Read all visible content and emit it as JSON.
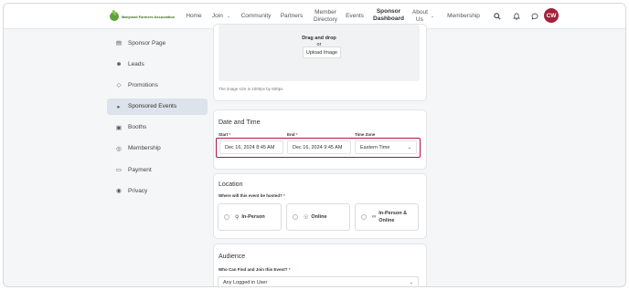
{
  "header": {
    "logo_text": "Maryland Farmers Association",
    "nav": [
      {
        "label": "Home"
      },
      {
        "label": "Join"
      },
      {
        "label": "Community"
      },
      {
        "label": "Partners"
      },
      {
        "label": "Member Directory"
      },
      {
        "label": "Events"
      },
      {
        "label": "Sponsor Dashboard"
      },
      {
        "label": "About Us"
      },
      {
        "label": "Membership"
      }
    ],
    "avatar_initials": "CW"
  },
  "sidebar": {
    "items": [
      {
        "label": "Sponsor Page",
        "icon": "sponsor-page-icon"
      },
      {
        "label": "Leads",
        "icon": "users-icon"
      },
      {
        "label": "Promotions",
        "icon": "tag-icon"
      },
      {
        "label": "Sponsored Events",
        "icon": "megaphone-icon"
      },
      {
        "label": "Booths",
        "icon": "booth-icon"
      },
      {
        "label": "Membership",
        "icon": "award-icon"
      },
      {
        "label": "Payment",
        "icon": "credit-card-icon"
      },
      {
        "label": "Privacy",
        "icon": "lock-icon"
      }
    ]
  },
  "upload": {
    "drag_text": "Drag and drop",
    "or_text": "or",
    "button_label": "Upload Image",
    "hint": "The image size is 1000px by 600px"
  },
  "datetime": {
    "title": "Date and Time",
    "start_label": "Start",
    "end_label": "End",
    "tz_label": "Time Zone",
    "start_value": "Dec 16, 2024 8:45 AM",
    "end_value": "Dec 16, 2024 9:45 AM",
    "tz_value": "Eastern Time",
    "required_mark": "*"
  },
  "location": {
    "title": "Location",
    "question": "Where will this event be hosted?",
    "required_mark": "*",
    "options": [
      {
        "label": "In-Person"
      },
      {
        "label": "Online"
      },
      {
        "label": "In-Person & Online"
      }
    ]
  },
  "audience": {
    "title": "Audience",
    "question": "Who Can Find and Join this Event?",
    "required_mark": "*",
    "value": "Any Logged in User"
  }
}
